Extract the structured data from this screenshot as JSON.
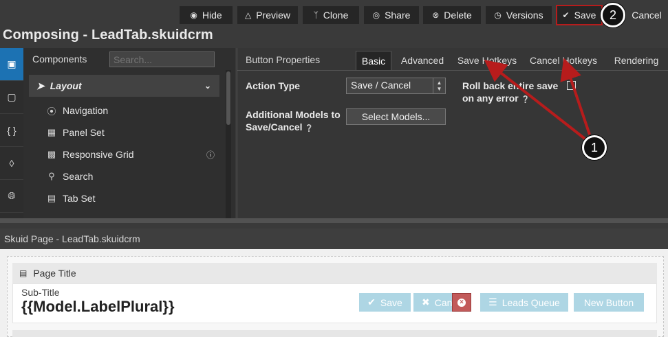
{
  "toolbar": {
    "hide": "Hide",
    "preview": "Preview",
    "clone": "Clone",
    "share": "Share",
    "delete": "Delete",
    "versions": "Versions",
    "save": "Save",
    "cancel": "Cancel"
  },
  "page_heading": "Composing - LeadTab.skuidcrm",
  "components": {
    "title": "Components",
    "search_placeholder": "Search...",
    "group_label": "Layout",
    "items": [
      {
        "label": "Navigation",
        "icon": "compass-icon"
      },
      {
        "label": "Panel Set",
        "icon": "panel-set-icon"
      },
      {
        "label": "Responsive Grid",
        "icon": "grid-icon"
      },
      {
        "label": "Search",
        "icon": "search-icon"
      },
      {
        "label": "Tab Set",
        "icon": "tab-set-icon"
      }
    ]
  },
  "properties": {
    "title": "Button Properties",
    "tabs": [
      "Basic",
      "Advanced",
      "Save Hotkeys",
      "Cancel Hotkeys",
      "Rendering"
    ],
    "active_tab": "Basic",
    "action_type_label": "Action Type",
    "action_type_value": "Save / Cancel",
    "additional_models_label_1": "Additional Models to",
    "additional_models_label_2": "Save/Cancel",
    "select_models_button": "Select Models...",
    "rollback_label_1": "Roll back entire save",
    "rollback_label_2": "on any error"
  },
  "preview": {
    "page_label": "Skuid Page - LeadTab.skuidcrm",
    "page_title_component": "Page Title",
    "subtitle": "Sub-Title",
    "title": "{{Model.LabelPlural}}",
    "buttons": {
      "save": "Save",
      "cancel": "Can",
      "leads_queue": "Leads Queue",
      "new_button": "New Button"
    }
  },
  "callouts": {
    "one": "1",
    "two": "2"
  },
  "colors": {
    "accent": "#1c72b3",
    "highlight": "#b71c1c",
    "arrow": "#b71c1c",
    "preview_button": "#aed6e4"
  }
}
